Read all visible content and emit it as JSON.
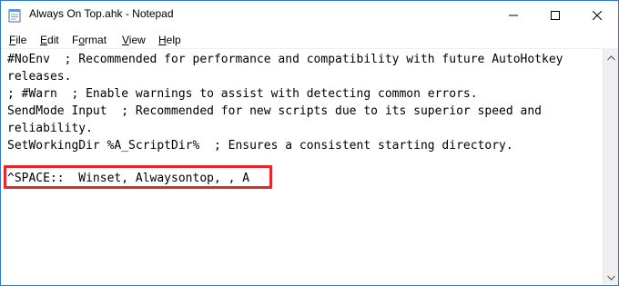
{
  "window": {
    "title": "Always On Top.ahk - Notepad"
  },
  "menu": {
    "items": [
      {
        "accel": "F",
        "rest": "ile"
      },
      {
        "accel": "E",
        "rest": "dit"
      },
      {
        "accel": "",
        "pre": "F",
        "mid": "o",
        "post": "rmat"
      },
      {
        "accel": "V",
        "rest": "iew"
      },
      {
        "accel": "H",
        "rest": "elp"
      }
    ]
  },
  "editor": {
    "lines": [
      "#NoEnv  ; Recommended for performance and compatibility with future AutoHotkey",
      "releases.",
      "; #Warn  ; Enable warnings to assist with detecting common errors.",
      "SendMode Input  ; Recommended for new scripts due to its superior speed and",
      "reliability.",
      "SetWorkingDir %A_ScriptDir%  ; Ensures a consistent starting directory.",
      "",
      "^SPACE::  Winset, Alwaysontop, , A"
    ]
  },
  "colors": {
    "highlight_border": "#e8262a",
    "window_border": "#2b79d6"
  },
  "icons": {
    "app": "notepad-icon",
    "minimize": "minimize-icon",
    "maximize": "maximize-icon",
    "close": "close-icon",
    "scroll_up": "chevron-up-icon",
    "scroll_down": "chevron-down-icon"
  }
}
